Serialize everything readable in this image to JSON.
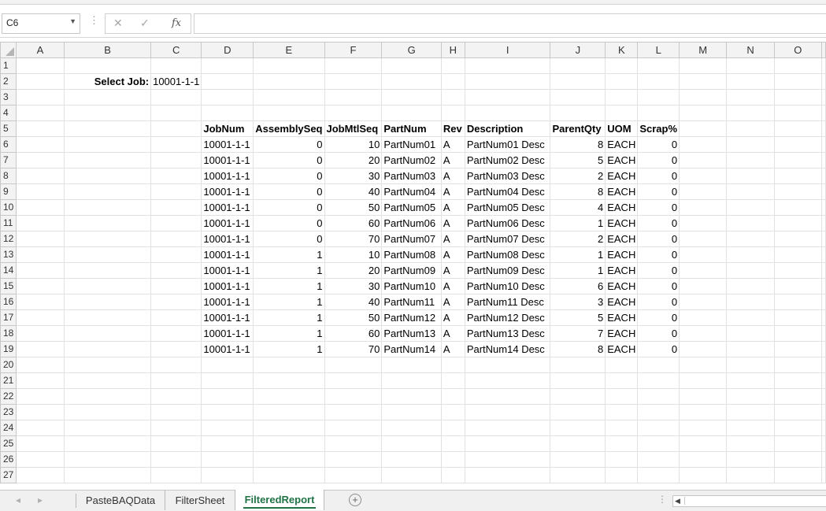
{
  "formula_bar": {
    "name_box": "C6",
    "formula": ""
  },
  "columns": [
    "A",
    "B",
    "C",
    "D",
    "E",
    "F",
    "G",
    "H",
    "I",
    "J",
    "K",
    "L",
    "M",
    "N",
    "O"
  ],
  "rows": [
    {
      "n": "1",
      "cells": [
        "",
        "",
        "",
        "",
        "",
        "",
        "",
        "",
        "",
        "",
        "",
        "",
        "",
        "",
        ""
      ]
    },
    {
      "n": "2",
      "cells": [
        "",
        "Select Job:",
        "10001-1-1",
        "",
        "",
        "",
        "",
        "",
        "",
        "",
        "",
        "",
        "",
        "",
        ""
      ]
    },
    {
      "n": "3",
      "cells": [
        "",
        "",
        "",
        "",
        "",
        "",
        "",
        "",
        "",
        "",
        "",
        "",
        "",
        "",
        ""
      ]
    },
    {
      "n": "4",
      "cells": [
        "",
        "",
        "",
        "",
        "",
        "",
        "",
        "",
        "",
        "",
        "",
        "",
        "",
        "",
        ""
      ]
    },
    {
      "n": "5",
      "cells": [
        "",
        "",
        "",
        "JobNum",
        "AssemblySeq",
        "JobMtlSeq",
        "PartNum",
        "Rev",
        "Description",
        "ParentQty",
        "UOM",
        "Scrap%",
        "",
        "",
        ""
      ]
    },
    {
      "n": "6",
      "cells": [
        "",
        "",
        "",
        "10001-1-1",
        "0",
        "10",
        "PartNum01",
        "A",
        "PartNum01 Desc",
        "8",
        "EACH",
        "0",
        "",
        "",
        ""
      ]
    },
    {
      "n": "7",
      "cells": [
        "",
        "",
        "",
        "10001-1-1",
        "0",
        "20",
        "PartNum02",
        "A",
        "PartNum02 Desc",
        "5",
        "EACH",
        "0",
        "",
        "",
        ""
      ]
    },
    {
      "n": "8",
      "cells": [
        "",
        "",
        "",
        "10001-1-1",
        "0",
        "30",
        "PartNum03",
        "A",
        "PartNum03 Desc",
        "2",
        "EACH",
        "0",
        "",
        "",
        ""
      ]
    },
    {
      "n": "9",
      "cells": [
        "",
        "",
        "",
        "10001-1-1",
        "0",
        "40",
        "PartNum04",
        "A",
        "PartNum04 Desc",
        "8",
        "EACH",
        "0",
        "",
        "",
        ""
      ]
    },
    {
      "n": "10",
      "cells": [
        "",
        "",
        "",
        "10001-1-1",
        "0",
        "50",
        "PartNum05",
        "A",
        "PartNum05 Desc",
        "4",
        "EACH",
        "0",
        "",
        "",
        ""
      ]
    },
    {
      "n": "11",
      "cells": [
        "",
        "",
        "",
        "10001-1-1",
        "0",
        "60",
        "PartNum06",
        "A",
        "PartNum06 Desc",
        "1",
        "EACH",
        "0",
        "",
        "",
        ""
      ]
    },
    {
      "n": "12",
      "cells": [
        "",
        "",
        "",
        "10001-1-1",
        "0",
        "70",
        "PartNum07",
        "A",
        "PartNum07 Desc",
        "2",
        "EACH",
        "0",
        "",
        "",
        ""
      ]
    },
    {
      "n": "13",
      "cells": [
        "",
        "",
        "",
        "10001-1-1",
        "1",
        "10",
        "PartNum08",
        "A",
        "PartNum08 Desc",
        "1",
        "EACH",
        "0",
        "",
        "",
        ""
      ]
    },
    {
      "n": "14",
      "cells": [
        "",
        "",
        "",
        "10001-1-1",
        "1",
        "20",
        "PartNum09",
        "A",
        "PartNum09 Desc",
        "1",
        "EACH",
        "0",
        "",
        "",
        ""
      ]
    },
    {
      "n": "15",
      "cells": [
        "",
        "",
        "",
        "10001-1-1",
        "1",
        "30",
        "PartNum10",
        "A",
        "PartNum10 Desc",
        "6",
        "EACH",
        "0",
        "",
        "",
        ""
      ]
    },
    {
      "n": "16",
      "cells": [
        "",
        "",
        "",
        "10001-1-1",
        "1",
        "40",
        "PartNum11",
        "A",
        "PartNum11 Desc",
        "3",
        "EACH",
        "0",
        "",
        "",
        ""
      ]
    },
    {
      "n": "17",
      "cells": [
        "",
        "",
        "",
        "10001-1-1",
        "1",
        "50",
        "PartNum12",
        "A",
        "PartNum12 Desc",
        "5",
        "EACH",
        "0",
        "",
        "",
        ""
      ]
    },
    {
      "n": "18",
      "cells": [
        "",
        "",
        "",
        "10001-1-1",
        "1",
        "60",
        "PartNum13",
        "A",
        "PartNum13 Desc",
        "7",
        "EACH",
        "0",
        "",
        "",
        ""
      ]
    },
    {
      "n": "19",
      "cells": [
        "",
        "",
        "",
        "10001-1-1",
        "1",
        "70",
        "PartNum14",
        "A",
        "PartNum14 Desc",
        "8",
        "EACH",
        "0",
        "",
        "",
        ""
      ]
    },
    {
      "n": "20",
      "cells": [
        "",
        "",
        "",
        "",
        "",
        "",
        "",
        "",
        "",
        "",
        "",
        "",
        "",
        "",
        ""
      ]
    },
    {
      "n": "21",
      "cells": [
        "",
        "",
        "",
        "",
        "",
        "",
        "",
        "",
        "",
        "",
        "",
        "",
        "",
        "",
        ""
      ]
    },
    {
      "n": "22",
      "cells": [
        "",
        "",
        "",
        "",
        "",
        "",
        "",
        "",
        "",
        "",
        "",
        "",
        "",
        "",
        ""
      ]
    },
    {
      "n": "23",
      "cells": [
        "",
        "",
        "",
        "",
        "",
        "",
        "",
        "",
        "",
        "",
        "",
        "",
        "",
        "",
        ""
      ]
    },
    {
      "n": "24",
      "cells": [
        "",
        "",
        "",
        "",
        "",
        "",
        "",
        "",
        "",
        "",
        "",
        "",
        "",
        "",
        ""
      ]
    },
    {
      "n": "25",
      "cells": [
        "",
        "",
        "",
        "",
        "",
        "",
        "",
        "",
        "",
        "",
        "",
        "",
        "",
        "",
        ""
      ]
    },
    {
      "n": "26",
      "cells": [
        "",
        "",
        "",
        "",
        "",
        "",
        "",
        "",
        "",
        "",
        "",
        "",
        "",
        "",
        ""
      ]
    },
    {
      "n": "27",
      "cells": [
        "",
        "",
        "",
        "",
        "",
        "",
        "",
        "",
        "",
        "",
        "",
        "",
        "",
        "",
        ""
      ]
    }
  ],
  "sheet_tabs": [
    "PasteBAQData",
    "FilterSheet",
    "FilteredReport"
  ],
  "active_tab": "FilteredReport",
  "colors": {
    "accent": "#217346",
    "header_bg": "#f3f3f3",
    "grid_line": "#e1e1e1"
  }
}
